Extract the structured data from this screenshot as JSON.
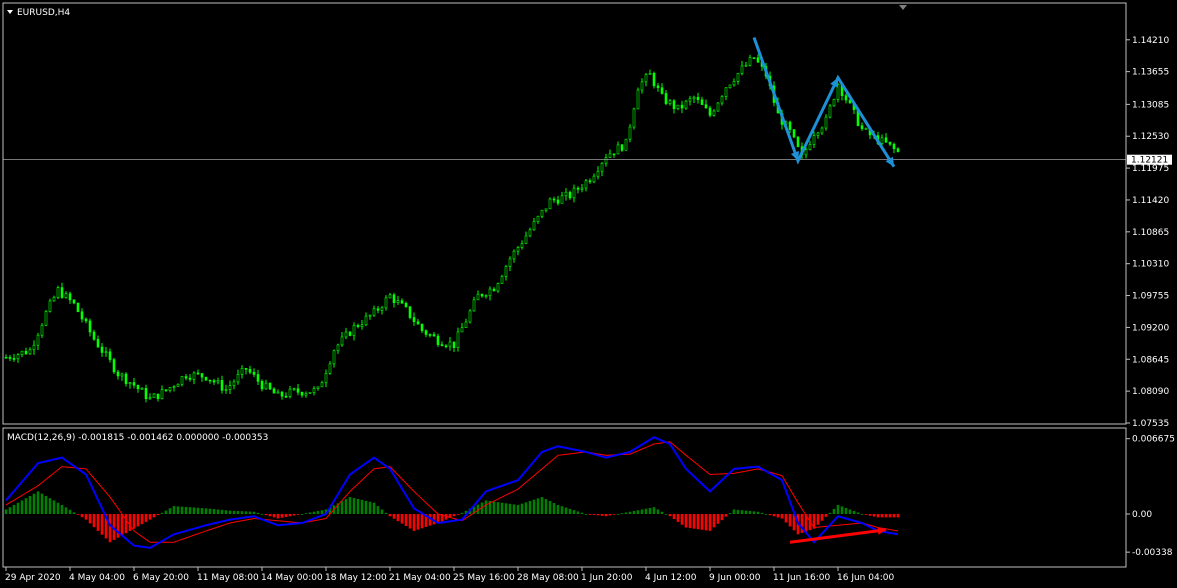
{
  "symbol_label": "EURUSD,H4",
  "macd_label": "MACD(12,26,9) -0.001815 -0.001462 0.000000 -0.000353",
  "current_price": "1.12121",
  "colors": {
    "background": "#000000",
    "frame": "#c0c0c0",
    "candle": "#00ff00",
    "price_line": "#c0c0c0",
    "annotation_zigzag": "#1e90d6",
    "annotation_arrow": "#ff0000",
    "macd_line": "#0000ff",
    "signal_line": "#ff0000",
    "hist_positive": "#008000",
    "hist_negative": "#ff0000"
  },
  "chart_data": [
    {
      "type": "candlestick",
      "name": "EURUSD,H4",
      "ylim": [
        1.07535,
        1.1445
      ],
      "y_ticks": [
        "1.14210",
        "1.13655",
        "1.13085",
        "1.12530",
        "1.11975",
        "1.11420",
        "1.10865",
        "1.10310",
        "1.09755",
        "1.09200",
        "1.08645",
        "1.08090",
        "1.07535"
      ],
      "x_ticks": [
        "29 Apr 2020",
        "4 May 04:00",
        "6 May 20:00",
        "11 May 08:00",
        "14 May 00:00",
        "18 May 12:00",
        "21 May 04:00",
        "25 May 16:00",
        "28 May 08:00",
        "1 Jun 20:00",
        "4 Jun 12:00",
        "9 Jun 00:00",
        "11 Jun 16:00",
        "16 Jun 04:00"
      ],
      "bars": 224,
      "close_path": [
        [
          0,
          1.0868
        ],
        [
          6,
          1.088
        ],
        [
          10,
          1.0945
        ],
        [
          13,
          1.0985
        ],
        [
          17,
          1.096
        ],
        [
          22,
          1.09
        ],
        [
          28,
          1.084
        ],
        [
          32,
          1.082
        ],
        [
          36,
          1.0795
        ],
        [
          40,
          1.081
        ],
        [
          45,
          1.0838
        ],
        [
          50,
          1.0835
        ],
        [
          55,
          1.0812
        ],
        [
          60,
          1.0848
        ],
        [
          64,
          1.082
        ],
        [
          68,
          1.08
        ],
        [
          72,
          1.0808
        ],
        [
          78,
          1.081
        ],
        [
          82,
          1.0882
        ],
        [
          87,
          1.092
        ],
        [
          92,
          1.0945
        ],
        [
          96,
          1.0975
        ],
        [
          100,
          1.095
        ],
        [
          104,
          1.0915
        ],
        [
          108,
          1.0898
        ],
        [
          112,
          1.089
        ],
        [
          118,
          1.0975
        ],
        [
          122,
          1.099
        ],
        [
          126,
          1.104
        ],
        [
          131,
          1.109
        ],
        [
          136,
          1.114
        ],
        [
          141,
          1.115
        ],
        [
          146,
          1.118
        ],
        [
          150,
          1.122
        ],
        [
          155,
          1.124
        ],
        [
          158,
          1.134
        ],
        [
          161,
          1.136
        ],
        [
          164,
          1.132
        ],
        [
          168,
          1.13
        ],
        [
          172,
          1.132
        ],
        [
          176,
          1.129
        ],
        [
          180,
          1.134
        ],
        [
          184,
          1.137
        ],
        [
          187,
          1.139
        ],
        [
          190,
          1.136
        ],
        [
          193,
          1.129
        ],
        [
          196,
          1.126
        ],
        [
          199,
          1.1215
        ],
        [
          202,
          1.126
        ],
        [
          205,
          1.128
        ],
        [
          208,
          1.1345
        ],
        [
          211,
          1.1305
        ],
        [
          214,
          1.1265
        ],
        [
          217,
          1.125
        ],
        [
          220,
          1.124
        ],
        [
          223,
          1.1225
        ]
      ],
      "current_price": 1.12121,
      "annotations": [
        {
          "type": "zigzag",
          "points": [
            [
              187,
              1.1425
            ],
            [
              198,
              1.121
            ],
            [
              208,
              1.1355
            ],
            [
              222,
              1.12
            ]
          ]
        }
      ]
    },
    {
      "type": "macd",
      "name": "MACD(12,26,9)",
      "ylim": [
        -0.0039,
        0.007
      ],
      "y_ticks": [
        "0.006675",
        "0.00",
        "-0.00338"
      ],
      "macd_path": [
        [
          0,
          0.0012
        ],
        [
          8,
          0.0045
        ],
        [
          14,
          0.005
        ],
        [
          20,
          0.0035
        ],
        [
          26,
          -0.001
        ],
        [
          32,
          -0.0028
        ],
        [
          36,
          -0.003
        ],
        [
          42,
          -0.0018
        ],
        [
          50,
          -0.001
        ],
        [
          56,
          -0.0005
        ],
        [
          62,
          -0.0002
        ],
        [
          68,
          -0.001
        ],
        [
          74,
          -0.0008
        ],
        [
          80,
          0.0
        ],
        [
          86,
          0.0035
        ],
        [
          92,
          0.005
        ],
        [
          96,
          0.004
        ],
        [
          102,
          0.0005
        ],
        [
          108,
          -0.0008
        ],
        [
          114,
          -0.0005
        ],
        [
          120,
          0.002
        ],
        [
          128,
          0.003
        ],
        [
          134,
          0.0055
        ],
        [
          138,
          0.006
        ],
        [
          145,
          0.0055
        ],
        [
          150,
          0.005
        ],
        [
          156,
          0.0055
        ],
        [
          162,
          0.0068
        ],
        [
          166,
          0.0062
        ],
        [
          170,
          0.004
        ],
        [
          176,
          0.002
        ],
        [
          182,
          0.004
        ],
        [
          188,
          0.0042
        ],
        [
          194,
          0.003
        ],
        [
          198,
          -0.0008
        ],
        [
          202,
          -0.0025
        ],
        [
          208,
          -0.0002
        ],
        [
          214,
          -0.0008
        ],
        [
          218,
          -0.0015
        ],
        [
          223,
          -0.0018
        ]
      ],
      "signal_path": [
        [
          0,
          0.0008
        ],
        [
          8,
          0.0025
        ],
        [
          14,
          0.0042
        ],
        [
          20,
          0.004
        ],
        [
          26,
          0.0015
        ],
        [
          32,
          -0.0015
        ],
        [
          36,
          -0.0025
        ],
        [
          42,
          -0.0025
        ],
        [
          50,
          -0.0015
        ],
        [
          56,
          -0.0008
        ],
        [
          62,
          -0.0004
        ],
        [
          68,
          -0.0006
        ],
        [
          74,
          -0.0008
        ],
        [
          80,
          -0.0004
        ],
        [
          86,
          0.002
        ],
        [
          92,
          0.004
        ],
        [
          96,
          0.0042
        ],
        [
          102,
          0.002
        ],
        [
          108,
          0.0
        ],
        [
          114,
          -0.0006
        ],
        [
          120,
          0.0008
        ],
        [
          128,
          0.0022
        ],
        [
          134,
          0.004
        ],
        [
          138,
          0.0052
        ],
        [
          145,
          0.0055
        ],
        [
          150,
          0.0052
        ],
        [
          156,
          0.0053
        ],
        [
          162,
          0.0062
        ],
        [
          166,
          0.0064
        ],
        [
          170,
          0.0052
        ],
        [
          176,
          0.0035
        ],
        [
          182,
          0.0036
        ],
        [
          188,
          0.004
        ],
        [
          194,
          0.0034
        ],
        [
          198,
          0.001
        ],
        [
          202,
          -0.0012
        ],
        [
          208,
          -0.001
        ],
        [
          214,
          -0.0008
        ],
        [
          218,
          -0.0012
        ],
        [
          223,
          -0.0015
        ]
      ],
      "annotations": [
        {
          "type": "arrow",
          "from": [
            196,
            -0.0025
          ],
          "to": [
            220,
            -0.0014
          ]
        }
      ]
    }
  ]
}
